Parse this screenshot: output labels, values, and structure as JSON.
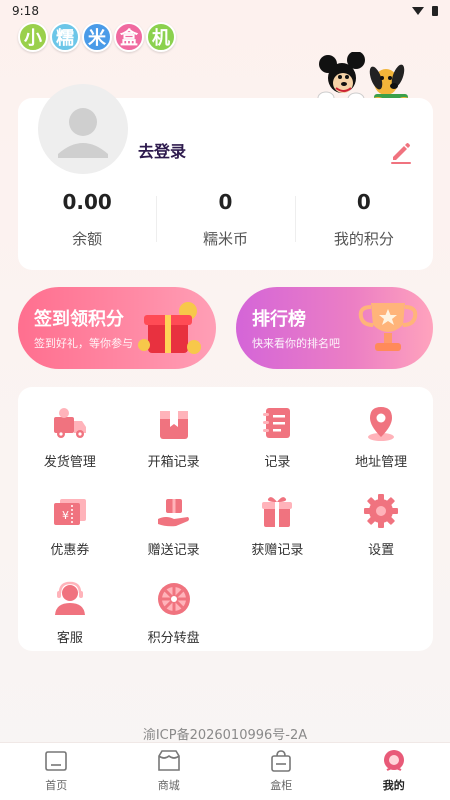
{
  "status_bar": {
    "time": "9:18"
  },
  "app": {
    "logo_chars": [
      "小",
      "糯",
      "米",
      "盒",
      "机"
    ],
    "logo_colors": [
      "#9ad04b",
      "#6cc6e8",
      "#4a9be8",
      "#f06aa0",
      "#8bd14e"
    ]
  },
  "profile": {
    "login_label": "去登录",
    "stats": [
      {
        "value": "0.00",
        "label": "余额"
      },
      {
        "value": "0",
        "label": "糯米币"
      },
      {
        "value": "0",
        "label": "我的积分"
      }
    ]
  },
  "banners": {
    "sign_in": {
      "title": "签到领积分",
      "subtitle": "签到好礼，等你参与"
    },
    "ranking": {
      "title": "排行榜",
      "subtitle": "快来看你的排名吧"
    }
  },
  "menu": {
    "items": [
      {
        "label": "发货管理",
        "icon": "delivery-truck-icon"
      },
      {
        "label": "开箱记录",
        "icon": "box-icon"
      },
      {
        "label": "记录",
        "icon": "notebook-icon"
      },
      {
        "label": "地址管理",
        "icon": "location-pin-icon"
      },
      {
        "label": "优惠券",
        "icon": "coupon-icon"
      },
      {
        "label": "赠送记录",
        "icon": "gift-hand-icon"
      },
      {
        "label": "获赠记录",
        "icon": "gift-box-icon"
      },
      {
        "label": "设置",
        "icon": "gear-icon"
      },
      {
        "label": "客服",
        "icon": "customer-service-icon"
      },
      {
        "label": "积分转盘",
        "icon": "wheel-icon"
      }
    ]
  },
  "footer": {
    "icp": "渝ICP备2026010996号-2A"
  },
  "tabbar": {
    "tabs": [
      {
        "label": "首页",
        "icon": "home-icon"
      },
      {
        "label": "商城",
        "icon": "shop-icon"
      },
      {
        "label": "盒柜",
        "icon": "box-cabinet-icon"
      },
      {
        "label": "我的",
        "icon": "profile-icon"
      }
    ],
    "active_index": 3
  },
  "colors": {
    "accent": "#f0737f",
    "accent_light": "#ffd6da",
    "active_tab": "#e85a78"
  }
}
